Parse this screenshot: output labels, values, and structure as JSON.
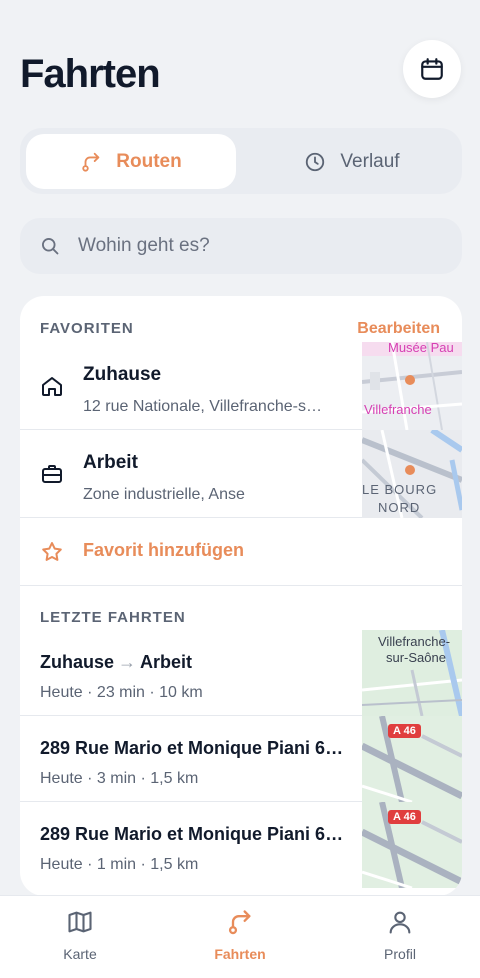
{
  "header": {
    "title": "Fahrten"
  },
  "segmented": {
    "routes_label": "Routen",
    "history_label": "Verlauf"
  },
  "search": {
    "placeholder": "Wohin geht es?"
  },
  "favorites": {
    "section_label": "FAVORITEN",
    "edit_label": "Bearbeiten",
    "items": [
      {
        "title": "Zuhause",
        "subtitle": "12 rue Nationale, Villefranche-s…",
        "map_labels": [
          "Musée Pau",
          "Villefranche"
        ]
      },
      {
        "title": "Arbeit",
        "subtitle": "Zone industrielle, Anse",
        "map_labels": [
          "LE BOURG",
          "NORD"
        ]
      }
    ],
    "add_label": "Favorit hinzufügen"
  },
  "recent": {
    "section_label": "LETZTE FAHRTEN",
    "trips": [
      {
        "from": "Zuhause",
        "to": "Arbeit",
        "meta": "Heute · 23 min · 10 km",
        "map_labels": [
          "Villefranche-",
          "sur-Saône"
        ]
      },
      {
        "title": "289 Rue Mario et Monique Piani 6…",
        "meta": "Heute · 3 min · 1,5 km",
        "road_badge": "A 46"
      },
      {
        "title": "289 Rue Mario et Monique Piani 6…",
        "meta": "Heute · 1 min · 1,5 km",
        "road_badge": "A 46"
      }
    ]
  },
  "tabbar": {
    "tabs": [
      {
        "label": "Karte"
      },
      {
        "label": "Fahrten"
      },
      {
        "label": "Profil"
      }
    ]
  },
  "colors": {
    "accent": "#e88c5a",
    "text": "#111a2b",
    "muted": "#5b6474",
    "background": "#f0f2f5"
  },
  "icons": [
    "calendar-icon",
    "route-icon",
    "clock-icon",
    "search-icon",
    "home-icon",
    "briefcase-icon",
    "star-icon",
    "map-icon",
    "user-icon"
  ]
}
